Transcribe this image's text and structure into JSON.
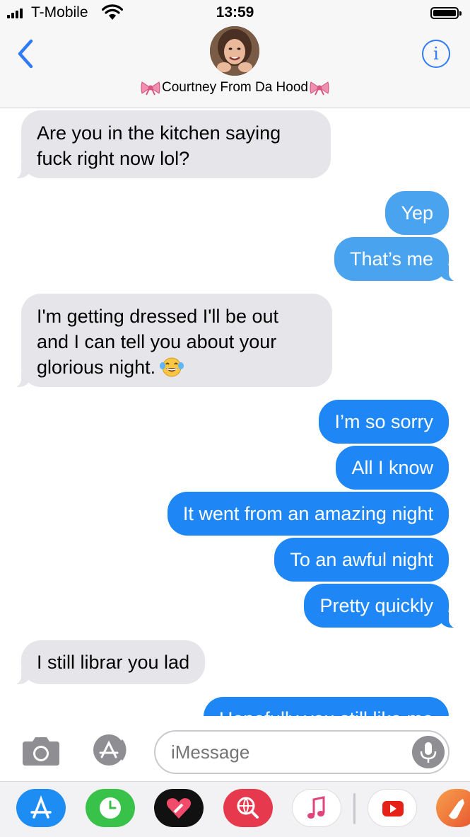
{
  "status_bar": {
    "carrier": "T-Mobile",
    "time": "13:59"
  },
  "header": {
    "contact_name": "Courtney From Da Hood",
    "info_label": "i"
  },
  "messages": [
    {
      "from": "them",
      "text": "Are you in the kitchen saying\nfuck right now lol?"
    },
    {
      "from": "me",
      "text": "Yep"
    },
    {
      "from": "me",
      "text": "That’s me"
    },
    {
      "from": "them",
      "text": "I'm getting dressed I'll be out\nand I can tell you about your\nglorious night."
    },
    {
      "from": "me",
      "text": "I’m so sorry"
    },
    {
      "from": "me",
      "text": "All I know"
    },
    {
      "from": "me",
      "text": "It went from an amazing night"
    },
    {
      "from": "me",
      "text": "To an awful night"
    },
    {
      "from": "me",
      "text": "Pretty quickly"
    },
    {
      "from": "them",
      "text": "I still librar you lad"
    },
    {
      "from": "me",
      "text": "Hopefully you still like me"
    }
  ],
  "input": {
    "placeholder": "iMessage"
  },
  "colors": {
    "sent": "#1f87f5",
    "received": "#e5e5ea",
    "accent": "#2f7cf6"
  },
  "icons": [
    "back-chevron-icon",
    "info-icon",
    "camera-icon",
    "app-store-icon",
    "microphone-icon",
    "bow-emoji-icon",
    "laughing-emoji-icon"
  ],
  "app_drawer": [
    "app-store",
    "clock",
    "digital-touch",
    "search-images",
    "music",
    "youtube",
    "garageband"
  ]
}
